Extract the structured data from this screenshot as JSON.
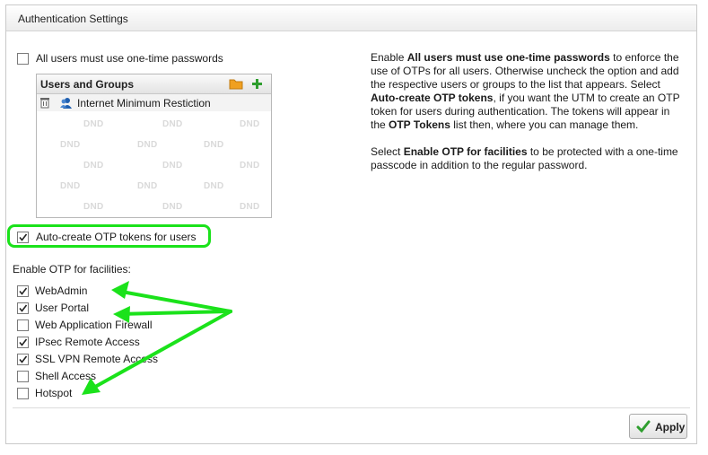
{
  "panel": {
    "title": "Authentication Settings"
  },
  "all_users_otp": {
    "label": "All users must use one-time passwords",
    "checked": false
  },
  "users_groups": {
    "title": "Users and Groups",
    "folder_icon": "folder-icon",
    "add_icon": "plus-icon",
    "entries": [
      {
        "name": "Internet Minimum Restiction",
        "icon": "user-group-icon"
      }
    ],
    "placeholder_text": "DND"
  },
  "auto_create": {
    "label": "Auto-create OTP tokens for users",
    "checked": true
  },
  "facilities": {
    "heading": "Enable OTP for facilities:",
    "items": [
      {
        "label": "WebAdmin",
        "checked": true
      },
      {
        "label": "User Portal",
        "checked": true
      },
      {
        "label": "Web Application Firewall",
        "checked": false
      },
      {
        "label": "IPsec Remote Access",
        "checked": true
      },
      {
        "label": "SSL VPN Remote Access",
        "checked": true
      },
      {
        "label": "Shell Access",
        "checked": false
      },
      {
        "label": "Hotspot",
        "checked": false
      }
    ]
  },
  "help": {
    "p1": [
      {
        "t": "Enable ",
        "b": false
      },
      {
        "t": "All users must use one-time passwords",
        "b": true
      },
      {
        "t": " to enforce the use of OTPs for all users. Otherwise uncheck the option and add the respective users or groups to the list that appears. Select ",
        "b": false
      },
      {
        "t": "Auto-create OTP tokens",
        "b": true
      },
      {
        "t": ", if you want the UTM to create an OTP token for users during authentication. The tokens will appear in the ",
        "b": false
      },
      {
        "t": "OTP Tokens",
        "b": true
      },
      {
        "t": " list then, where you can manage them.",
        "b": false
      }
    ],
    "p2": [
      {
        "t": "Select ",
        "b": false
      },
      {
        "t": "Enable OTP for facilities",
        "b": true
      },
      {
        "t": " to be protected with a one-time passcode in addition to the regular password.",
        "b": false
      }
    ]
  },
  "apply_button": {
    "label": "Apply",
    "icon": "checkmark-icon"
  },
  "colors": {
    "annotation_green": "#1be21b",
    "folder_orange": "#f0a020",
    "plus_green": "#2e9e2e",
    "user_blue": "#1f5fb0"
  }
}
